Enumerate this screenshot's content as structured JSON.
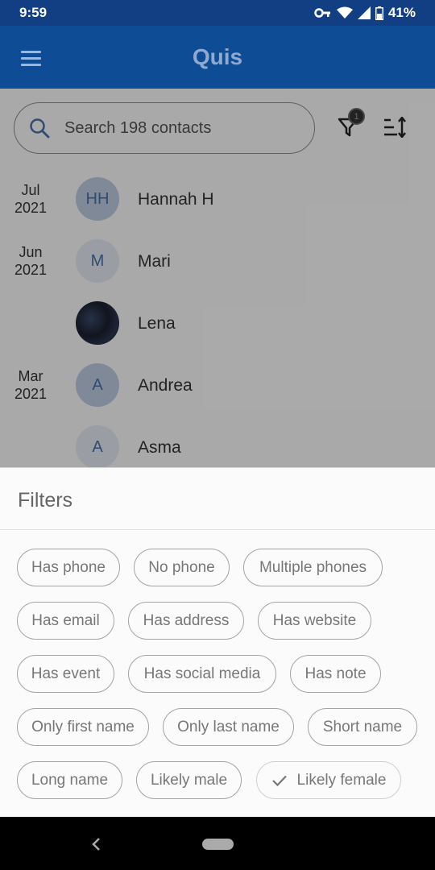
{
  "status": {
    "time": "9:59",
    "battery": "41%"
  },
  "app": {
    "title": "Quis"
  },
  "search": {
    "placeholder": "Search 198 contacts"
  },
  "filter_badge": "1",
  "contacts": [
    {
      "date_month": "Jul",
      "date_year": "2021",
      "initials": "HH",
      "name": "Hannah H"
    },
    {
      "date_month": "Jun",
      "date_year": "2021",
      "initials": "M",
      "name": "Mari"
    },
    {
      "date_month": "",
      "date_year": "",
      "initials": "",
      "name": "Lena"
    },
    {
      "date_month": "Mar",
      "date_year": "2021",
      "initials": "A",
      "name": "Andrea"
    },
    {
      "date_month": "",
      "date_year": "",
      "initials": "A",
      "name": "Asma"
    }
  ],
  "filters": {
    "title": "Filters",
    "chips": [
      {
        "label": "Has phone",
        "selected": false
      },
      {
        "label": "No phone",
        "selected": false
      },
      {
        "label": "Multiple phones",
        "selected": false
      },
      {
        "label": "Has email",
        "selected": false
      },
      {
        "label": "Has address",
        "selected": false
      },
      {
        "label": "Has website",
        "selected": false
      },
      {
        "label": "Has event",
        "selected": false
      },
      {
        "label": "Has social media",
        "selected": false
      },
      {
        "label": "Has note",
        "selected": false
      },
      {
        "label": "Only first name",
        "selected": false
      },
      {
        "label": "Only last name",
        "selected": false
      },
      {
        "label": "Short name",
        "selected": false
      },
      {
        "label": "Long name",
        "selected": false
      },
      {
        "label": "Likely male",
        "selected": false
      },
      {
        "label": "Likely female",
        "selected": true
      }
    ]
  },
  "colors": {
    "app_bar": "#0e4c96",
    "status_bar": "#123f84",
    "accent": "#4a6fa5"
  }
}
